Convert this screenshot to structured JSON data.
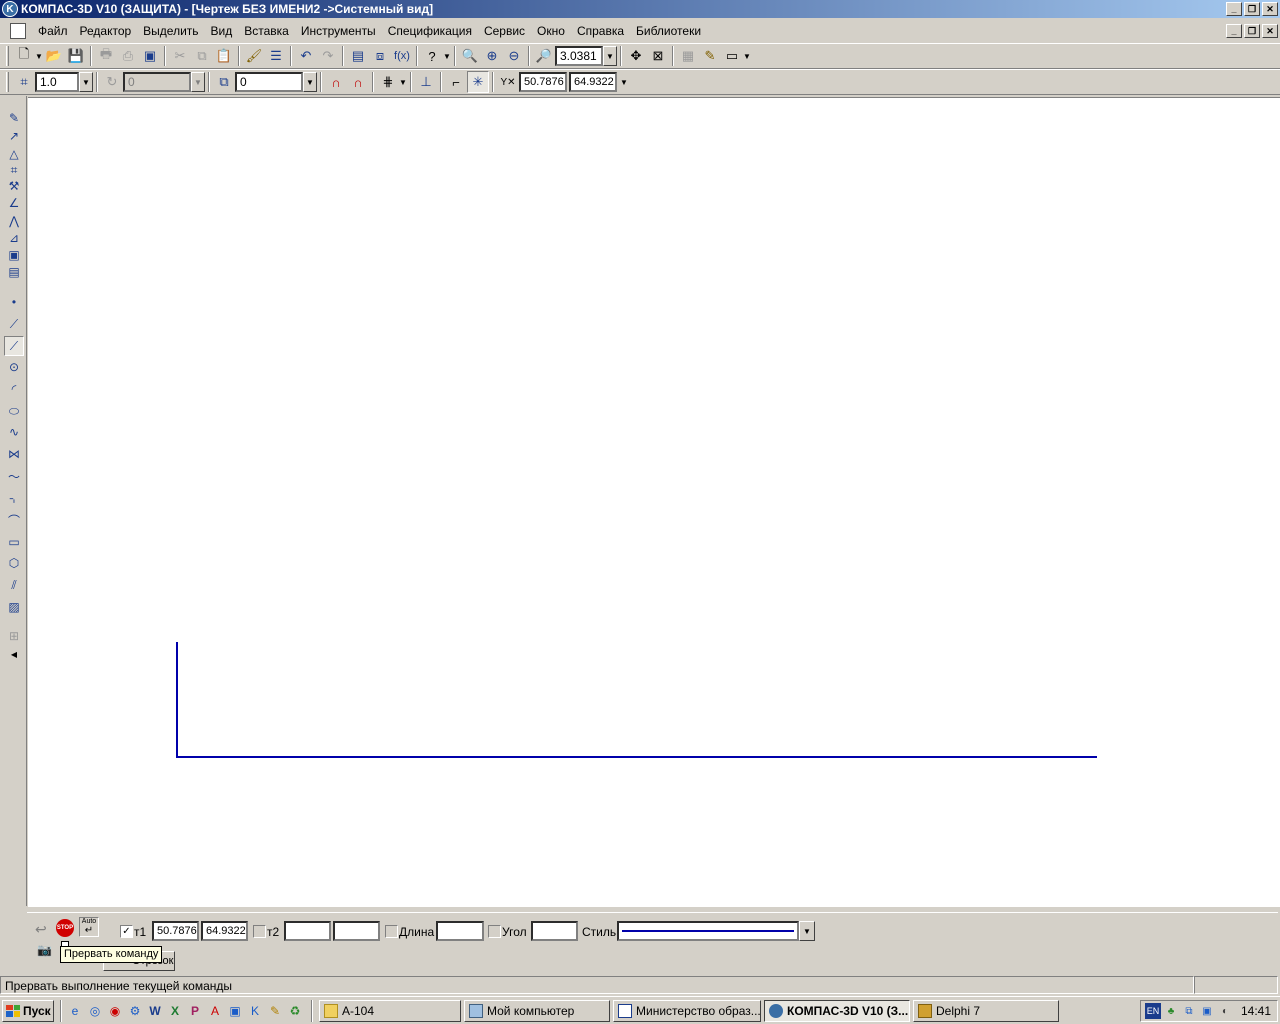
{
  "window": {
    "title": "КОМПАС-3D V10 (ЗАЩИТА) - [Чертеж БЕЗ ИМЕНИ2 ->Системный вид]",
    "app_icon_letter": "K"
  },
  "menu": {
    "items": [
      {
        "label": "Файл"
      },
      {
        "label": "Редактор"
      },
      {
        "label": "Выделить"
      },
      {
        "label": "Вид"
      },
      {
        "label": "Вставка"
      },
      {
        "label": "Инструменты"
      },
      {
        "label": "Спецификация"
      },
      {
        "label": "Сервис"
      },
      {
        "label": "Окно"
      },
      {
        "label": "Справка"
      },
      {
        "label": "Библиотеки"
      }
    ]
  },
  "toolbar1": {
    "zoom_value": "3.0381",
    "fx_label": "f(x)"
  },
  "toolbar2": {
    "step_value": "1.0",
    "angle_step_value": "0",
    "layer_value": "0",
    "coord_x": "50.7876",
    "coord_y": "64.9322"
  },
  "propbar": {
    "t1_label": "т1",
    "t1_x": "50.7876",
    "t1_y": "64.9322",
    "t2_label": "т2",
    "t2_x": "",
    "t2_y": "",
    "length_label": "Длина",
    "length_value": "",
    "angle_label": "Угол",
    "angle_value": "",
    "style_label": "Стиль",
    "stop_label": "STOP",
    "auto_label": "Auto",
    "tab_label": "Отрезок",
    "tooltip": "Прервать команду"
  },
  "statusbar": {
    "text": "Прервать выполнение текущей команды"
  },
  "drawing": {
    "line_color": "#0000aa"
  },
  "taskbar": {
    "start_label": "Пуск",
    "tasks": [
      {
        "label": "A-104",
        "icon": "folder-icon"
      },
      {
        "label": "Мой компьютер",
        "icon": "computer-icon"
      },
      {
        "label": "Министерство образ...",
        "icon": "word-icon"
      },
      {
        "label": "КОМПАС-3D V10 (З...",
        "icon": "kompas-icon",
        "active": true
      },
      {
        "label": "Delphi 7",
        "icon": "delphi-icon"
      }
    ],
    "lang": "EN",
    "clock": "14:41"
  },
  "colors": {
    "title_gradient_start": "#0a246a",
    "title_gradient_end": "#a6caf0",
    "face": "#d4d0c8",
    "drawing_line": "#0000aa"
  }
}
